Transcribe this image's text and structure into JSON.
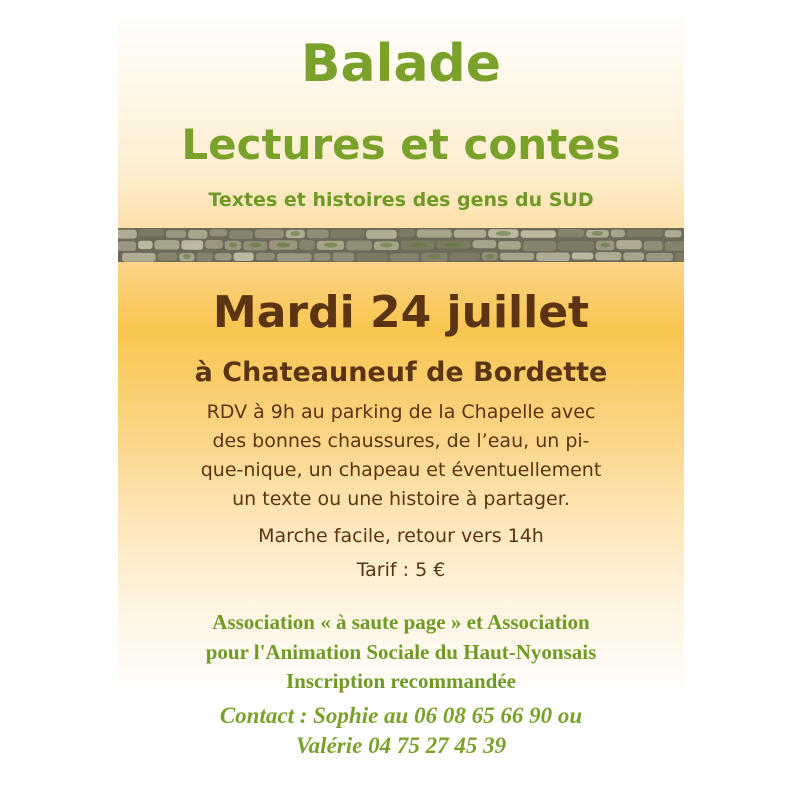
{
  "poster": {
    "title": "Balade",
    "subtitle": "Lectures et contes",
    "tagline": "Textes et histoires des gens du SUD",
    "date": "Mardi 24 juillet",
    "place": "à Chateauneuf de Bordette",
    "details": [
      "RDV à 9h au parking de la Chapelle avec",
      "des bonnes chaussures, de l’eau, un pi-",
      "que-nique, un chapeau et éventuellement",
      "un texte ou une histoire à partager."
    ],
    "walk": "Marche facile, retour vers 14h",
    "price": "Tarif : 5 €",
    "association": [
      "Association « à saute page » et Association",
      "pour l'Animation Sociale du Haut-Nyonsais",
      "Inscription recommandée"
    ],
    "contact": [
      "Contact : Sophie au 06 08 65 66 90 ou",
      "Valérie 04 75 27 45 39"
    ]
  },
  "colors": {
    "green": "#7aa12a",
    "brown": "#5b3513",
    "gradient_mid": "#f9c650"
  }
}
